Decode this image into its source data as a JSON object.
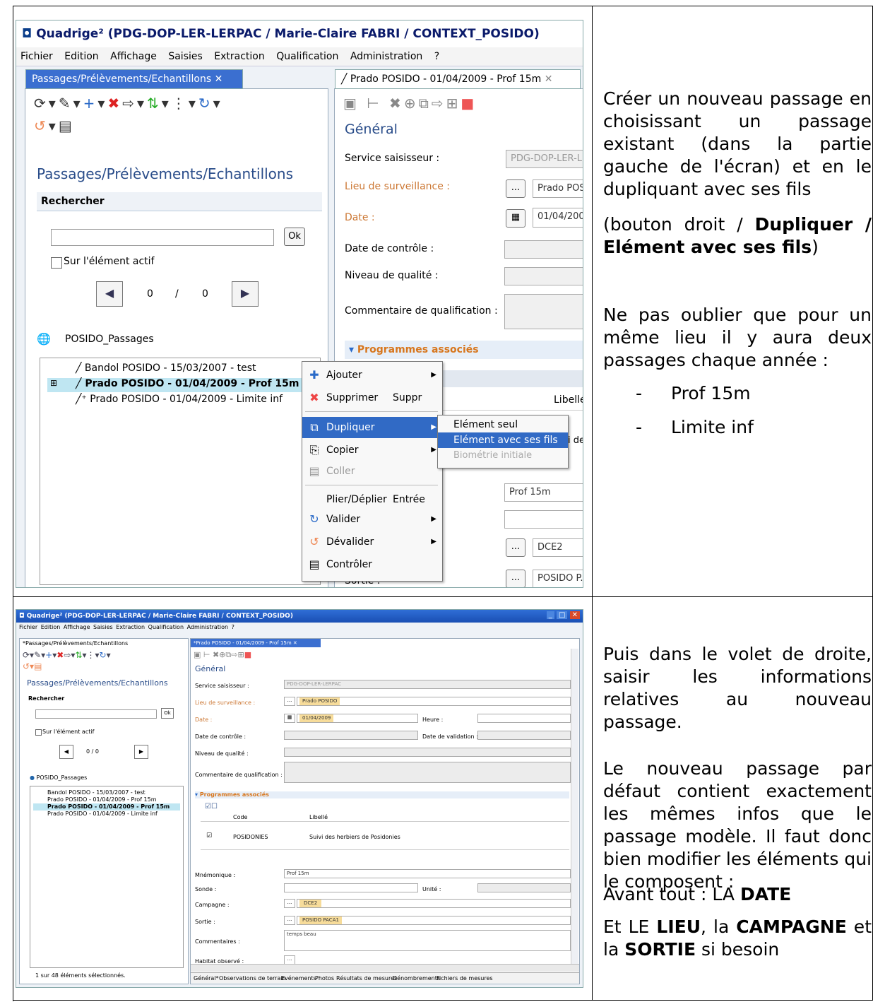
{
  "doc": {
    "row1": {
      "p1": "Créer un nouveau passage en choisissant un passage existant (dans la partie gauche de l'écran) et en le dupliquant avec ses fils",
      "p2_pre": "(bouton droit / ",
      "p2_bold": "Dupliquer / Elément avec ses fils",
      "p2_post": ")",
      "p3": "Ne pas oublier que pour un même lieu il y aura deux passages chaque année :",
      "bullets": [
        "Prof 15m",
        "Limite inf"
      ]
    },
    "row2": {
      "p1": "Puis dans le volet de droite, saisir les informations relatives au nouveau passage.",
      "p2": "Le nouveau passage par défaut contient exactement les mêmes infos que le passage modèle. Il faut donc bien modifier les éléments qui le composent :",
      "p3_pre": "Avant tout : LA ",
      "p3_bold": "DATE",
      "p4_a": "Et LE ",
      "p4_b": "LIEU",
      "p4_c": ", la ",
      "p4_d": "CAMPAGNE",
      "p4_e": " et la ",
      "p4_f": "SORTIE",
      "p4_g": " si besoin"
    }
  },
  "shot1": {
    "title": "Quadrige² (PDG-DOP-LER-LERPAC / Marie-Claire FABRI / CONTEXT_POSIDO)",
    "menu": [
      "Fichier",
      "Edition",
      "Affichage",
      "Saisies",
      "Extraction",
      "Qualification",
      "Administration",
      "?"
    ],
    "left_tab": "Passages/Prélèvements/Echantillons",
    "right_tab": "Prado POSIDO - 01/04/2009 - Prof 15m",
    "left_heading": "Passages/Prélèvements/Echantillons",
    "search_title": "Rechercher",
    "ok": "Ok",
    "active_only": "Sur l'élément actif",
    "nav_pos": "0",
    "nav_sep": "/",
    "nav_total": "0",
    "root": "POSIDO_Passages",
    "tree": [
      "Bandol POSIDO - 15/03/2007 - test",
      "Prado POSIDO - 01/04/2009 - Prof 15m",
      "Prado POSIDO - 01/04/2009 - Limite inf"
    ],
    "general": "Général",
    "labels": {
      "service": "Service saisisseur :",
      "lieu": "Lieu de surveillance :",
      "date": "Date :",
      "date_ctrl": "Date de contrôle :",
      "niveau": "Niveau de qualité :",
      "comment": "Commentaire de qualification :",
      "programmes": "Programmes associés",
      "libelle": "Libellé",
      "sortie": "Sortie :"
    },
    "values": {
      "service": "PDG-DOP-LER-LE",
      "lieu": "Prado POS",
      "date": "01/04/200",
      "mnemo": "Prof 15m",
      "campagne": "DCE2",
      "sortie": "POSIDO P."
    },
    "context_menu": {
      "ajouter": "Ajouter",
      "supprimer": "Supprimer",
      "supprimer_sc": "Suppr",
      "dupliquer": "Dupliquer",
      "copier": "Copier",
      "coller": "Coller",
      "plier": "Plier/Déplier",
      "plier_sc": "Entrée",
      "valider": "Valider",
      "devalider": "Dévalider",
      "controler": "Contrôler"
    },
    "submenu": [
      "Elément seul",
      "Elément avec ses fils",
      "Biométrie initiale"
    ],
    "frag_i": "i de"
  },
  "shot2": {
    "title": "Quadrige² (PDG-DOP-LER-LERPAC / Marie-Claire FABRI / CONTEXT_POSIDO)",
    "menu": "Fichier  Edition  Affichage  Saisies  Extraction  Qualification  Administration  ?",
    "left_tab": "*Passages/Prélèvements/Echantillons",
    "right_tab": "*Prado POSIDO - 01/04/2009 - Prof 15m",
    "left_heading": "Passages/Prélèvements/Echantillons",
    "search_title": "Rechercher",
    "ok": "Ok",
    "active_only": "Sur l'élément actif",
    "nav": "0   /   0",
    "root": "POSIDO_Passages",
    "tree": [
      "Bandol POSIDO - 15/03/2007 - test",
      "Prado POSIDO - 01/04/2009 - Prof 15m",
      "Prado POSIDO - 01/04/2009 - Prof 15m",
      "Prado POSIDO - 01/04/2009 - Limite inf"
    ],
    "status": {
      "count": "1",
      "sur": "sur",
      "total": "48",
      "label": "éléments sélectionnés."
    },
    "general": "Général",
    "labels": {
      "service": "Service saisisseur :",
      "lieu": "Lieu de surveillance :",
      "date": "Date :",
      "heure": "Heure :",
      "date_ctrl": "Date de contrôle :",
      "date_valid": "Date de validation :",
      "niveau": "Niveau de qualité :",
      "comment": "Commentaire de qualification :",
      "programmes": "Programmes associés",
      "code": "Code",
      "libelle": "Libellé",
      "mnemo": "Mnémonique :",
      "sonde": "Sonde :",
      "unite": "Unité :",
      "campagne": "Campagne :",
      "sortie": "Sortie :",
      "commentaires": "Commentaires :",
      "habitat": "Habitat observé :"
    },
    "values": {
      "service": "PDG-DOP-LER-LERPAC",
      "lieu": "Prado POSIDO",
      "date": "01/04/2009",
      "prog_code": "POSIDONIES",
      "prog_lib": "Suivi des herbiers de Posidonies",
      "mnemo": "Prof 15m",
      "campagne": "DCE2",
      "sortie": "POSIDO PACA1",
      "commentaires": "temps beau"
    },
    "bottom_tabs": [
      "Général*",
      "Observations de terrain",
      "Evénements",
      "Photos",
      "Résultats de mesures",
      "Dénombrements",
      "Fichiers de mesures"
    ]
  }
}
